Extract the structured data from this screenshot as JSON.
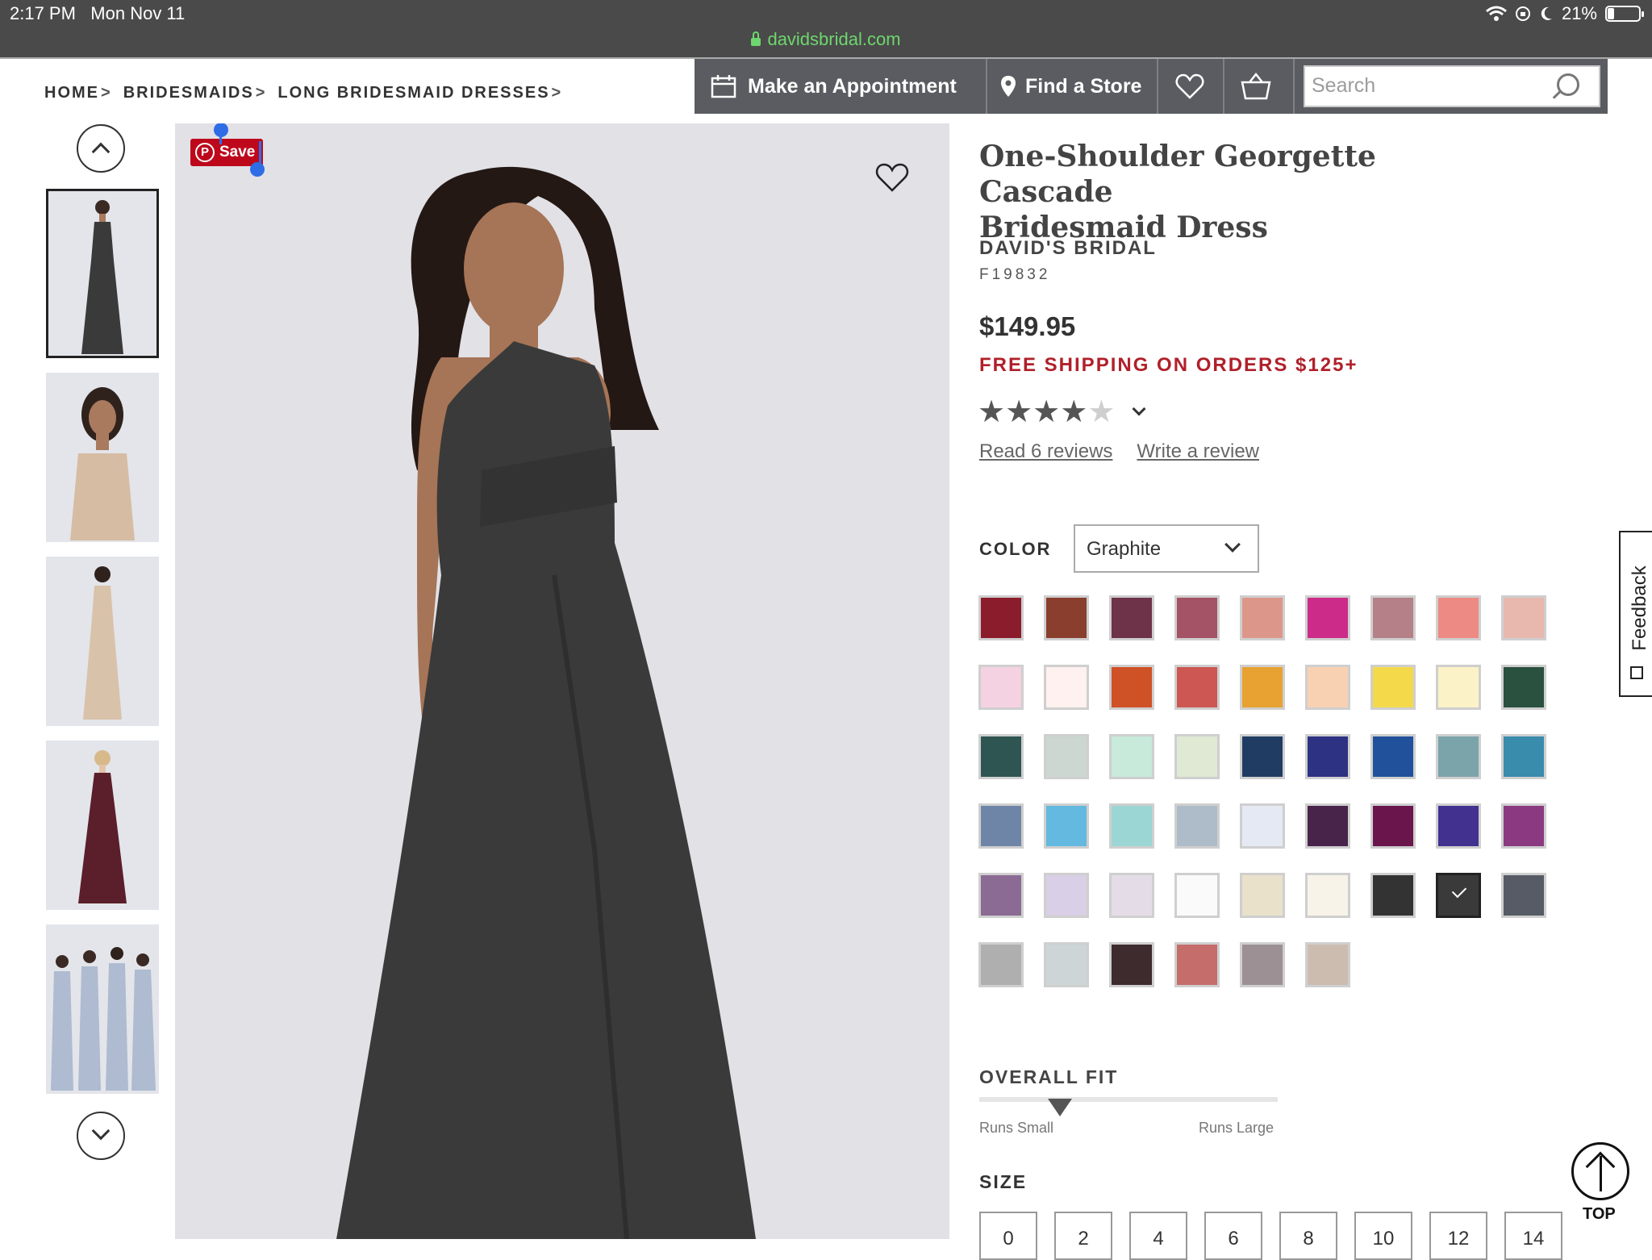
{
  "status_bar": {
    "time": "2:17 PM",
    "date": "Mon Nov 11",
    "battery": "21%",
    "battery_level": 0.21,
    "url": "davidsbridal.com"
  },
  "breadcrumb": [
    {
      "label": "HOME",
      "sep": ">"
    },
    {
      "label": "BRIDESMAIDS",
      "sep": ">"
    },
    {
      "label": "LONG BRIDESMAID DRESSES",
      "sep": ">"
    }
  ],
  "nav": {
    "appointment": "Make an Appointment",
    "find_store": "Find a Store",
    "search_placeholder": "Search"
  },
  "thumbnails": [
    {
      "dress_color": "#3a3a3a",
      "selected": true
    },
    {
      "dress_color": "#d6bca3",
      "selected": false
    },
    {
      "dress_color": "#d9c2aa",
      "selected": false
    },
    {
      "dress_color": "#5a1f2a",
      "selected": false
    },
    {
      "dress_color": "#aebbd0",
      "selected": false
    }
  ],
  "pinterest": {
    "label": "Save",
    "logo": "P"
  },
  "product": {
    "title_line1": "One-Shoulder Georgette Cascade",
    "title_line2": "Bridesmaid Dress",
    "brand": "DAVID'S BRIDAL",
    "sku": "F19832",
    "price": "$149.95",
    "shipping": "FREE SHIPPING ON ORDERS $125+",
    "rating": 4,
    "rating_max": 5,
    "read_reviews": "Read 6 reviews",
    "write_review": "Write a review"
  },
  "color": {
    "label": "COLOR",
    "selected": "Graphite",
    "swatches": [
      "#8b1c2c",
      "#8a3e2e",
      "#6e3249",
      "#a45266",
      "#dd978a",
      "#cc2b8a",
      "#b58087",
      "#ec8a83",
      "#e8b7ae",
      "#f4d2e2",
      "#fff1ef",
      "#cf5126",
      "#cd5752",
      "#e7a232",
      "#f8d1b3",
      "#f4da4a",
      "#fbf2c7",
      "#2a5140",
      "#2e5552",
      "#ccd7d1",
      "#c7eadb",
      "#dfe9d3",
      "#213c63",
      "#2d3282",
      "#22519c",
      "#7aa4a9",
      "#3a8cac",
      "#6e85a7",
      "#63b9df",
      "#9bd6d4",
      "#aebcc9",
      "#e5e9f4",
      "#48244a",
      "#6a164c",
      "#42318f",
      "#8b3a82",
      "#8b6a94",
      "#d9cfe6",
      "#e4dde7",
      "#fafafa",
      "#eae1cb",
      "#f7f3e8",
      "#333333",
      "#3a3a3a",
      "#565b65",
      "#afafaf",
      "#cdd5d7",
      "#3d2b2e",
      "#c46d6a",
      "#9c9095",
      "#ccbcb0"
    ],
    "selected_index": 43
  },
  "fit": {
    "label": "OVERALL FIT",
    "small": "Runs Small",
    "large": "Runs Large",
    "position": 0.27
  },
  "size": {
    "label": "SIZE",
    "options": [
      "0",
      "2",
      "4",
      "6",
      "8",
      "10",
      "12",
      "14"
    ]
  },
  "feedback": "Feedback",
  "top_label": "TOP"
}
